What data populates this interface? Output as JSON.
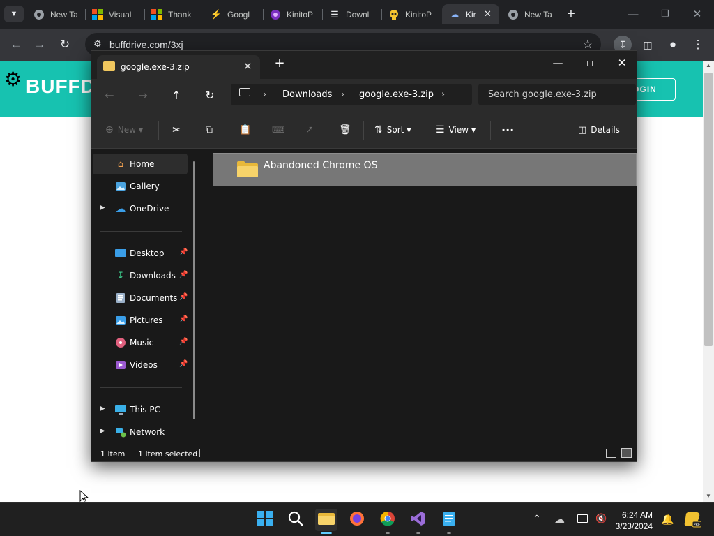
{
  "browser": {
    "tabs": [
      {
        "label": "New Ta",
        "icon": "chrome-icon"
      },
      {
        "label": "Visual",
        "icon": "microsoft-icon"
      },
      {
        "label": "Thank",
        "icon": "microsoft-icon"
      },
      {
        "label": "Googl",
        "icon": "bolt-icon"
      },
      {
        "label": "KinitoP",
        "icon": "kinito-icon"
      },
      {
        "label": "Downl",
        "icon": "stack-icon"
      },
      {
        "label": "KinitoP",
        "icon": "skull-icon"
      },
      {
        "label": "Kir",
        "icon": "cloud-icon"
      },
      {
        "label": "New Ta",
        "icon": "chrome-icon"
      }
    ],
    "url": "buffdrive.com/3xj"
  },
  "site": {
    "logo_text": "BUFFD",
    "login_label": "OGIN"
  },
  "explorer": {
    "tab_title": "google.exe-3.zip",
    "breadcrumb": [
      "Downloads",
      "google.exe-3.zip"
    ],
    "search_placeholder": "Search google.exe-3.zip",
    "commands": {
      "new": "New",
      "sort": "Sort",
      "view": "View",
      "more": "···",
      "details": "Details"
    },
    "nav": {
      "home": "Home",
      "gallery": "Gallery",
      "onedrive": "OneDrive",
      "desktop": "Desktop",
      "downloads": "Downloads",
      "documents": "Documents",
      "pictures": "Pictures",
      "music": "Music",
      "videos": "Videos",
      "thispc": "This PC",
      "network": "Network"
    },
    "files": [
      {
        "name": "Abandoned Chrome OS",
        "type": "folder"
      }
    ],
    "status": {
      "count": "1 item",
      "selected": "1 item selected"
    }
  },
  "taskbar": {
    "time": "6:24 AM",
    "date": "3/23/2024"
  }
}
